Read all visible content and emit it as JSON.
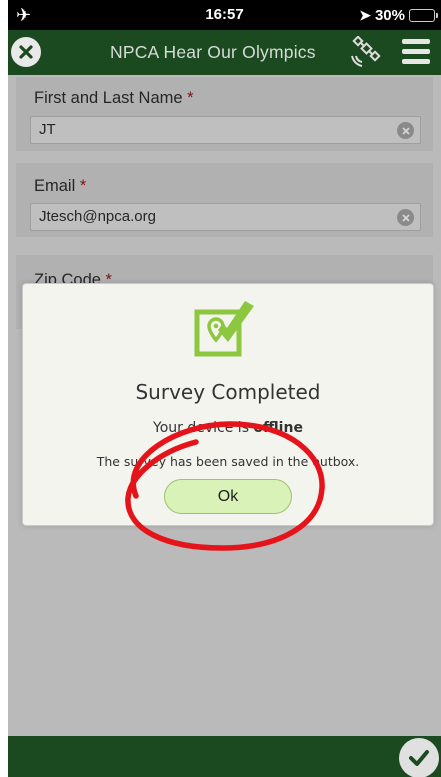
{
  "status_bar": {
    "time": "16:57",
    "battery_text": "30%",
    "battery_level": 0.3
  },
  "header": {
    "title": "NPCA Hear Our Olympics",
    "icons": [
      "close-icon",
      "satellite-icon",
      "hamburger-menu-icon"
    ],
    "color": "#1c4a20"
  },
  "form": {
    "fields": [
      {
        "label": "First and Last Name",
        "required_mark": "*",
        "value": "JT"
      },
      {
        "label": "Email",
        "required_mark": "*",
        "value": "Jtesch@npca.org"
      },
      {
        "label": "Zip Code",
        "required_mark": "*",
        "value": ""
      }
    ]
  },
  "dialog": {
    "icon": "checked-location-icon",
    "title": "Survey Completed",
    "status_prefix": "Your device is ",
    "status_value": "offline",
    "message": "The survey has been saved in the outbox.",
    "ok_label": "Ok",
    "accent": "#8dc63f"
  },
  "footer": {
    "icon": "submit-check-icon"
  }
}
